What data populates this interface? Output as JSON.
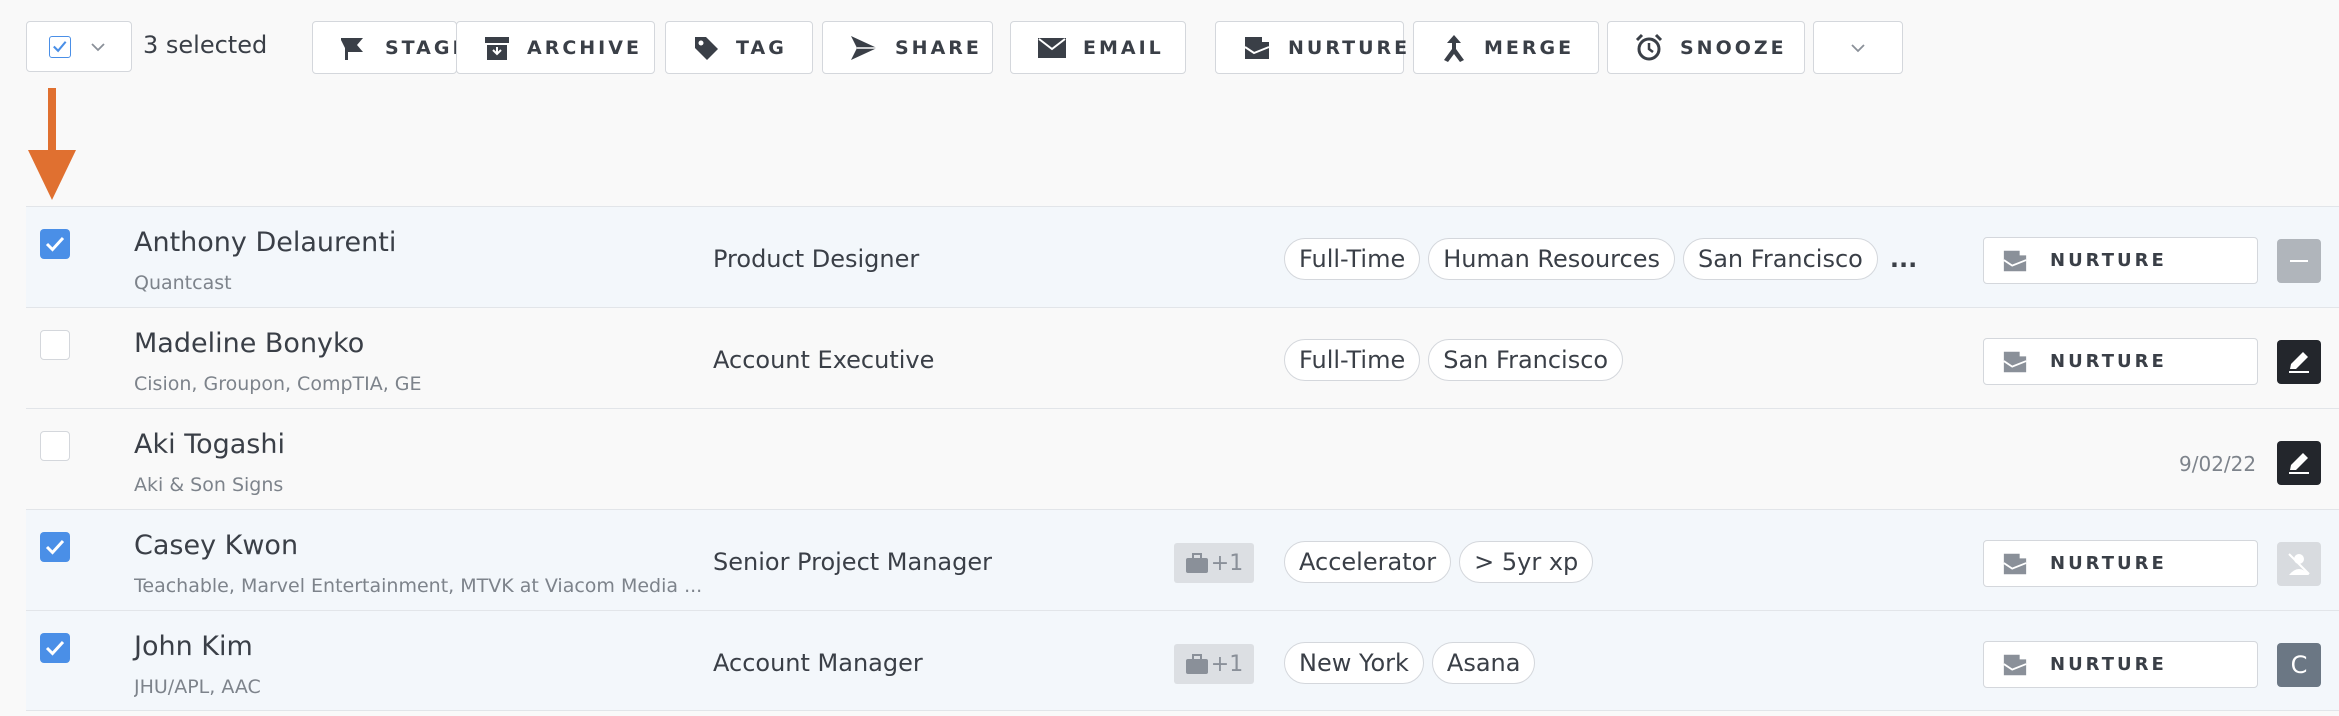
{
  "toolbar": {
    "selected_count": "3 selected",
    "buttons": [
      {
        "label": "STAGE",
        "icon": "flag-icon"
      },
      {
        "label": "ARCHIVE",
        "icon": "archive-icon"
      },
      {
        "label": "TAG",
        "icon": "tag-icon"
      },
      {
        "label": "SHARE",
        "icon": "paper-plane-icon"
      },
      {
        "label": "EMAIL",
        "icon": "envelope-icon"
      },
      {
        "label": "NURTURE",
        "icon": "inbox-stack-icon"
      },
      {
        "label": "MERGE",
        "icon": "merge-icon"
      },
      {
        "label": "SNOOZE",
        "icon": "alarm-clock-icon"
      }
    ]
  },
  "colors": {
    "accent": "#4a8fe7",
    "arrow": "#e07030",
    "selected_row": "#f3f7fb"
  },
  "rows": [
    {
      "checked": true,
      "name": "Anthony Delaurenti",
      "company": "Quantcast",
      "title": "Product Designer",
      "extra": "",
      "tags": [
        "Full-Time",
        "Human Resources",
        "San Francisco"
      ],
      "more_tags": "...",
      "action": "NURTURE",
      "date": "",
      "avatar": ""
    },
    {
      "checked": false,
      "name": "Madeline Bonyko",
      "company": "Cision, Groupon, CompTIA, GE",
      "title": "Account Executive",
      "extra": "",
      "tags": [
        "Full-Time",
        "San Francisco"
      ],
      "more_tags": "",
      "action": "NURTURE",
      "date": "",
      "avatar": ""
    },
    {
      "checked": false,
      "name": "Aki Togashi",
      "company": "Aki & Son Signs",
      "title": "",
      "extra": "",
      "tags": [],
      "more_tags": "",
      "action": "",
      "date": "9/02/22",
      "avatar": ""
    },
    {
      "checked": true,
      "name": "Casey Kwon",
      "company": "Teachable, Marvel Entertainment, MTVK at Viacom Media ...",
      "title": "Senior Project Manager",
      "extra": "+1",
      "tags": [
        "Accelerator",
        "> 5yr xp"
      ],
      "more_tags": "",
      "action": "NURTURE",
      "date": "",
      "avatar": ""
    },
    {
      "checked": true,
      "name": "John Kim",
      "company": "JHU/APL, AAC",
      "title": "Account Manager",
      "extra": "+1",
      "tags": [
        "New York",
        "Asana"
      ],
      "more_tags": "",
      "action": "NURTURE",
      "date": "",
      "avatar": "C"
    }
  ]
}
